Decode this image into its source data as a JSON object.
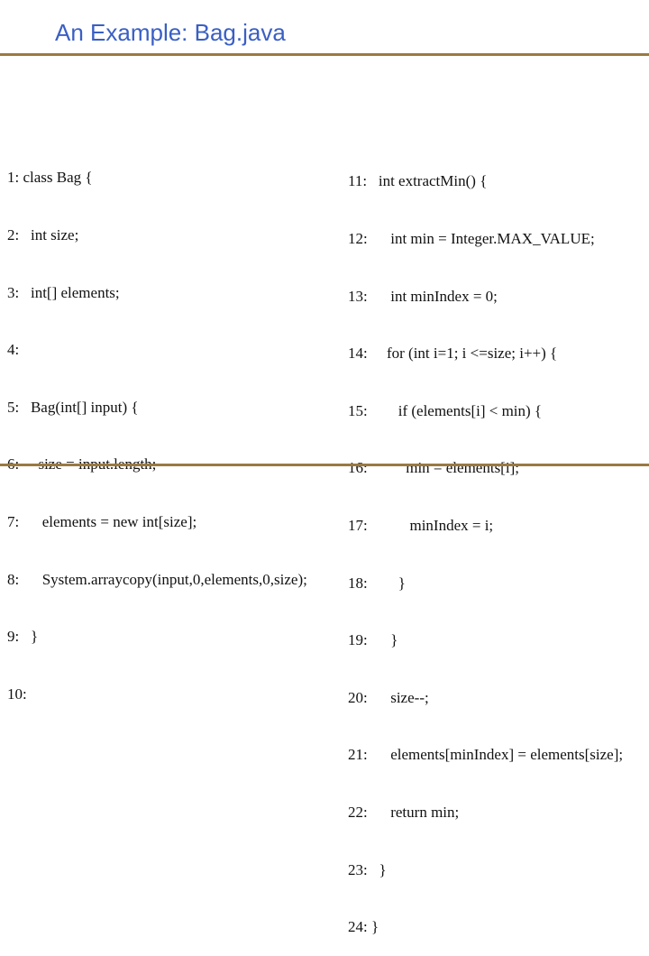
{
  "slide": {
    "title": "An Example: Bag.java",
    "accent_color": "#3a5fc4",
    "rule_color": "#9a7a42"
  },
  "code_left": [
    "1: class Bag {",
    "2:   int size;",
    "3:   int[] elements;",
    "4:",
    "5:   Bag(int[] input) {",
    "6:     size = input.length;",
    "7:      elements = new int[size];",
    "8:      System.arraycopy(input,0,elements,0,size);",
    "9:   }",
    "10:"
  ],
  "code_right": [
    "11:   int extractMin() {",
    "12:      int min = Integer.MAX_VALUE;",
    "13:      int minIndex = 0;",
    "14:     for (int i=1; i <=size; i++) {",
    "15:        if (elements[i] < min) {",
    "16:          min = elements[i];",
    "17:           minIndex = i;",
    "18:        }",
    "19:      }",
    "20:      size--;",
    "21:      elements[minIndex] = elements[size];",
    "22:      return min;",
    "23:   }",
    "24: }"
  ]
}
